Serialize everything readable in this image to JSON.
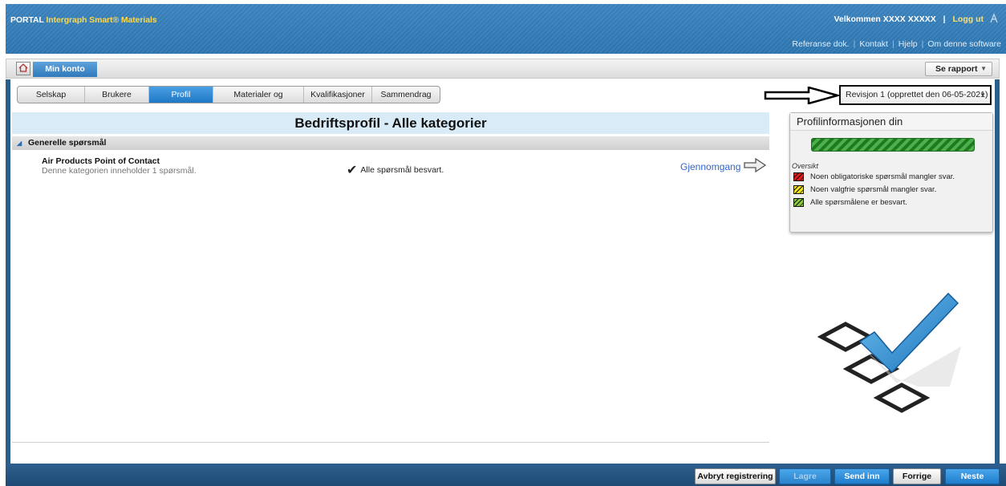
{
  "header": {
    "portal": "PORTAL",
    "product": "Intergraph Smart® Materials",
    "welcome": "Velkommen XXXX XXXXX",
    "separator": "|",
    "logout": "Logg ut",
    "links": [
      "Referanse dok.",
      "Kontakt",
      "Hjelp",
      "Om denne software"
    ],
    "link_separator": "|"
  },
  "account_bar": {
    "tab": "Min konto",
    "report_button": "Se rapport"
  },
  "breadcrumb": [
    "Selskap",
    "Brukere",
    "Profil",
    "Materialer og tjenester",
    "Kvalifikasjoner",
    "Sammendrag"
  ],
  "breadcrumb_active": "Profil",
  "revision": {
    "selected": "Revisjon 1 (opprettet den 06-05-2021)"
  },
  "main": {
    "title": "Bedriftsprofil - Alle kategorier",
    "section": "Generelle spørsmål",
    "row": {
      "title": "Air Products Point of Contact",
      "subtitle": "Denne kategorien inneholder 1 spørsmål.",
      "status": "Alle spørsmål besvart.",
      "review": "Gjennomgang"
    }
  },
  "info_panel": {
    "title": "Profilinformasjonen din",
    "progress": 1.0,
    "overview_label": "Oversikt",
    "legend": [
      {
        "label": "Noen obligatoriske spørsmål mangler svar.",
        "color": "#e01a1a"
      },
      {
        "label": "Noen valgfrie spørsmål mangler svar.",
        "color": "#f0e11e"
      },
      {
        "label": "Alle spørsmålene er besvart.",
        "color": "#8ac73b"
      }
    ]
  },
  "footer": {
    "cancel": "Avbryt registrering",
    "save": "Lagre",
    "submit": "Send inn",
    "previous": "Forrige",
    "next": "Neste"
  },
  "colors": {
    "accent": "#2f79bb",
    "header": "#3a84c0",
    "title_band": "#d8ebf6",
    "link": "#3366cc"
  },
  "icons": {
    "home": "home-icon",
    "check": "checkmark-icon",
    "review_arrow": "arrow-right-icon",
    "annotation_arrow": "arrow-right-outline-icon",
    "decoration": "checklist-icon"
  }
}
